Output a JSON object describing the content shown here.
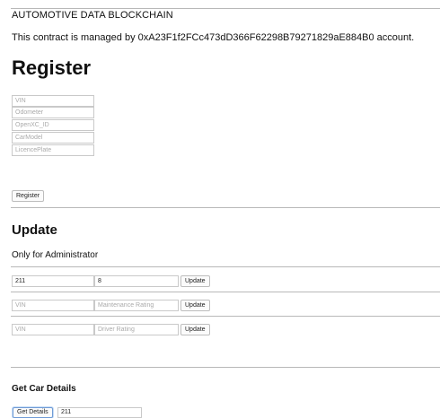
{
  "app_title": "AUTOMOTIVE DATA BLOCKCHAIN",
  "contract_text": "This contract is managed by 0xA23F1f2FCc473dD366F62298B79271829aE884B0 account.",
  "register": {
    "heading": "Register",
    "fields": [
      {
        "placeholder": "VIN"
      },
      {
        "placeholder": "Odometer"
      },
      {
        "placeholder": "OpenXC_ID"
      },
      {
        "placeholder": "CarModel"
      },
      {
        "placeholder": "LicencePlate"
      }
    ],
    "button_label": "Register"
  },
  "update": {
    "heading": "Update",
    "subheading": "Only for Administrator",
    "rows": [
      {
        "vin_value": "211",
        "vin_placeholder": "VIN",
        "second_value": "8",
        "second_placeholder": "",
        "button_label": "Update"
      },
      {
        "vin_value": "",
        "vin_placeholder": "VIN",
        "second_value": "",
        "second_placeholder": "Maintenance Rating",
        "button_label": "Update"
      },
      {
        "vin_value": "",
        "vin_placeholder": "VIN",
        "second_value": "",
        "second_placeholder": "Driver Rating",
        "button_label": "Update"
      }
    ]
  },
  "details": {
    "heading": "Get Car Details",
    "button_label": "Get Details",
    "vin_value": "211"
  }
}
